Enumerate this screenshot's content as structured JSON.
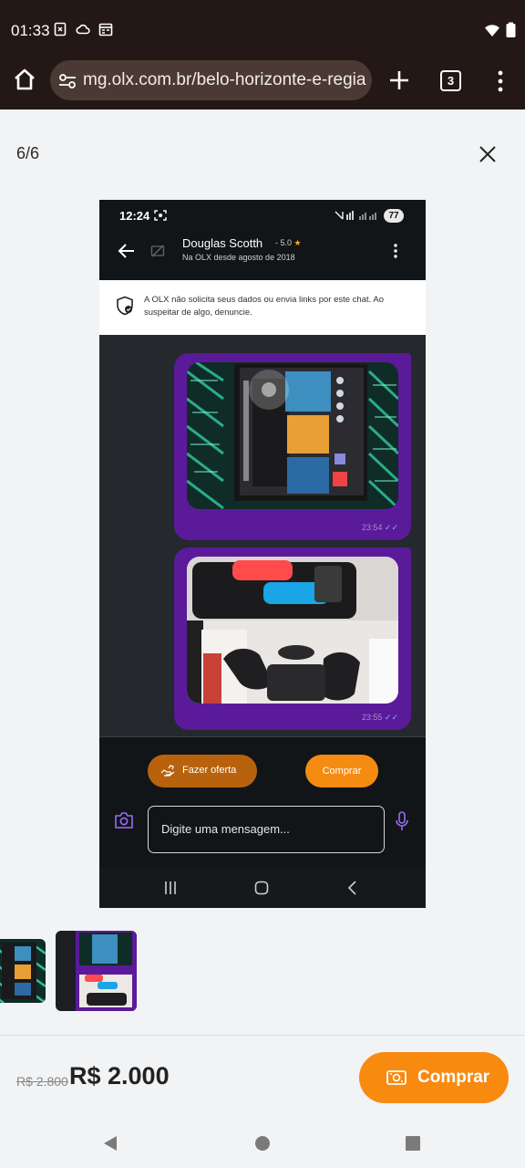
{
  "status_bar": {
    "time": "01:33",
    "icons": [
      "sim-icon",
      "cloud-icon",
      "calendar-icon",
      "wifi-icon",
      "battery-icon"
    ]
  },
  "browser": {
    "url": "mg.olx.com.br/belo-horizonte-e-regia",
    "tab_count": "3",
    "icons": [
      "home-icon",
      "site-settings-icon",
      "plus-icon",
      "menu-icon"
    ]
  },
  "viewer": {
    "counter": "6/6",
    "close_icon": "close-icon"
  },
  "photo": {
    "status_time": "12:24",
    "battery": "77",
    "chat_header": {
      "name": "Douglas Scotth",
      "rating": "- 5.0",
      "since": "Na OLX desde agosto de 2018"
    },
    "warning": "A OLX não solicita seus dados ou envia links por este chat. Ao suspeitar de algo, denuncie.",
    "messages": [
      {
        "time": "23:54"
      },
      {
        "time": "23:55"
      }
    ],
    "offer_label": "Fazer oferta",
    "buy_label": "Comprar",
    "input_placeholder": "Digite uma mensagem...",
    "colors": {
      "bubble": "#5b1a9a",
      "orange": "#f68b12",
      "offer": "#b8620d"
    }
  },
  "bottom": {
    "old_price": "R$ 2.800",
    "price": "R$ 2.000",
    "buy_label": "Comprar",
    "accent": "#f88a10"
  }
}
